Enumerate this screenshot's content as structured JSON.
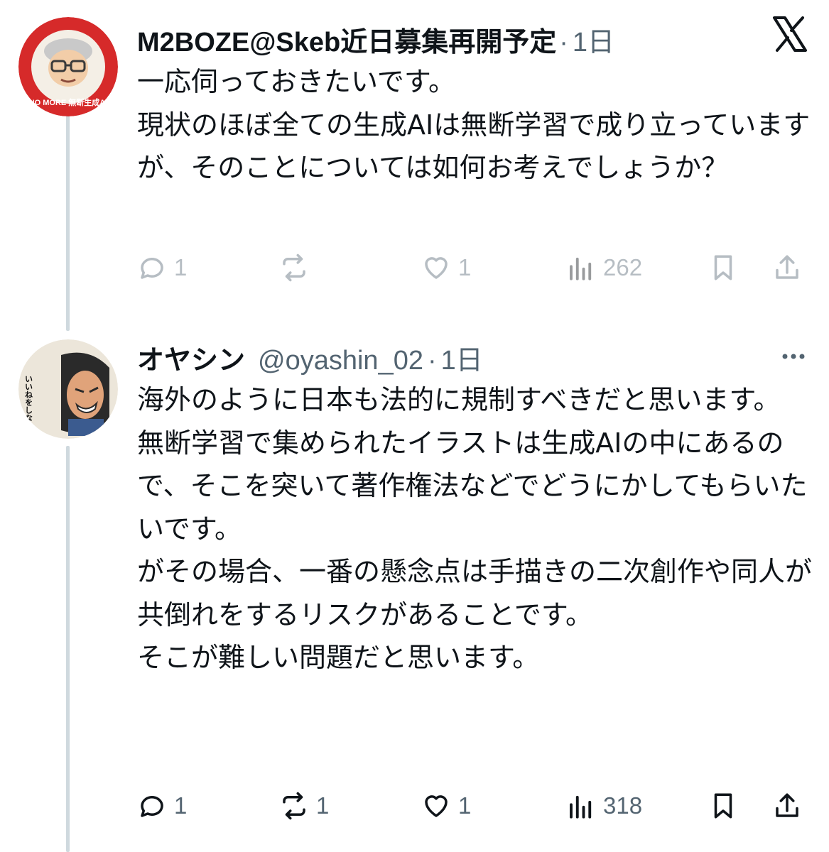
{
  "brand": {
    "logo_icon": "x-logo-icon",
    "accent": "#0f1419",
    "muted": "#536471"
  },
  "tweets": [
    {
      "display_name": "M2BOZE@Skeb近日募集再開予定",
      "handle": "",
      "dot": "·",
      "time": "1日",
      "avatar_text": "NO MORE 無断生成AI",
      "body": "一応伺っておきたいです。\n現状のほぼ全ての生成AIは無断学習で成り立っていますが、そのことについては如何お考えでしょうか？",
      "actions": {
        "reply_count": "1",
        "retweet_count": "",
        "like_count": "1",
        "views_count": "262"
      }
    },
    {
      "display_name": "オヤシン",
      "handle": "@oyashin_02",
      "dot": "·",
      "time": "1日",
      "avatar_text": "いいねをしないのかキサマッ",
      "body": "海外のように日本も法的に規制すべきだと思います。\n無断学習で集められたイラストは生成AIの中にあるので、そこを突いて著作権法などでどうにかしてもらいたいです。\nがその場合、一番の懸念点は手描きの二次創作や同人が共倒れをするリスクがあることです。\nそこが難しい問題だと思います。",
      "actions": {
        "reply_count": "1",
        "retweet_count": "1",
        "like_count": "1",
        "views_count": "318"
      }
    }
  ]
}
